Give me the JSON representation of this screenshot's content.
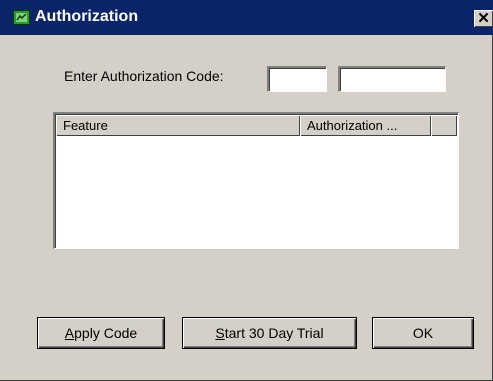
{
  "window": {
    "title": "Authorization",
    "close_glyph": "✕",
    "app_icon": "authorization-app-icon"
  },
  "form": {
    "code_label": "Enter Authorization Code:",
    "code_part1_value": "",
    "code_part2_value": ""
  },
  "list": {
    "columns": [
      "Feature",
      "Authorization ..."
    ],
    "rows": []
  },
  "buttons": {
    "apply_accel": "A",
    "apply_rest": "pply Code",
    "trial_accel": "S",
    "trial_rest": "tart 30 Day Trial",
    "ok_label": "OK"
  },
  "colors": {
    "titlebar": "#0a246a",
    "face": "#d4d0c8"
  }
}
